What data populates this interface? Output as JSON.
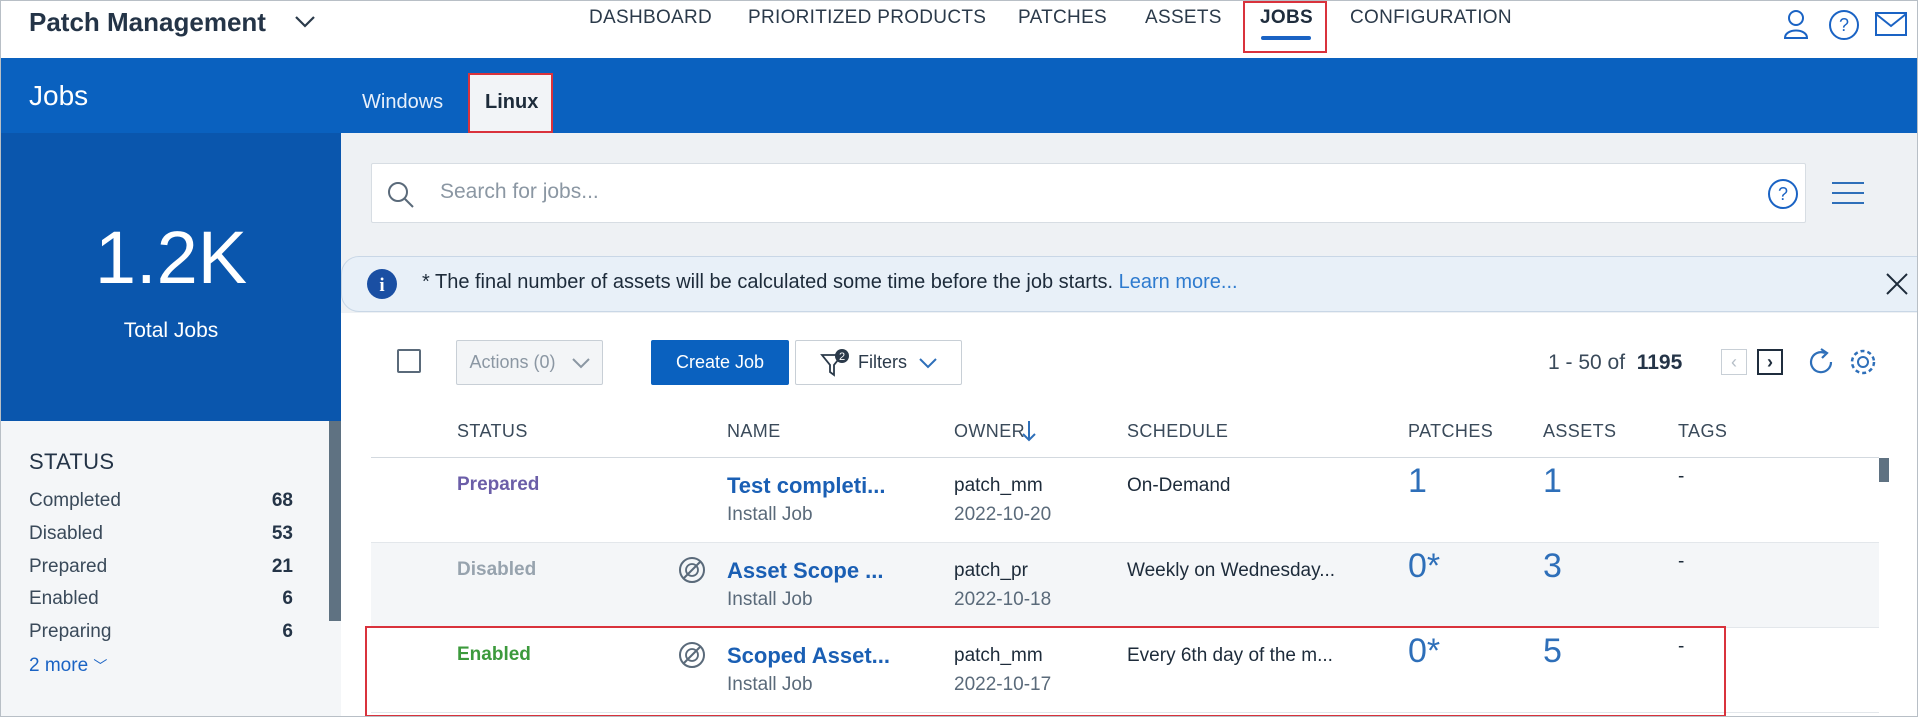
{
  "header": {
    "app_title": "Patch Management",
    "nav": [
      "DASHBOARD",
      "PRIORITIZED PRODUCTS",
      "PATCHES",
      "ASSETS",
      "JOBS",
      "CONFIGURATION"
    ],
    "active_nav": "JOBS"
  },
  "band": {
    "title": "Jobs",
    "tabs": [
      "Windows",
      "Linux"
    ],
    "active_tab": "Linux"
  },
  "kpi": {
    "value": "1.2K",
    "label": "Total Jobs"
  },
  "status": {
    "heading": "STATUS",
    "items": [
      {
        "label": "Completed",
        "count": "68"
      },
      {
        "label": "Disabled",
        "count": "53"
      },
      {
        "label": "Prepared",
        "count": "21"
      },
      {
        "label": "Enabled",
        "count": "6"
      },
      {
        "label": "Preparing",
        "count": "6"
      }
    ],
    "more": "2 more"
  },
  "search": {
    "placeholder": "Search for jobs..."
  },
  "info": {
    "text": "* The final number of assets will be calculated some time before the job starts.",
    "link": "Learn more..."
  },
  "toolbar": {
    "actions": "Actions (0)",
    "create": "Create Job",
    "filters": "Filters",
    "filter_badge": "2",
    "range": "1 - 50 of",
    "total": "1195"
  },
  "columns": [
    "STATUS",
    "NAME",
    "OWNER",
    "SCHEDULE",
    "PATCHES",
    "ASSETS",
    "TAGS"
  ],
  "rows": [
    {
      "status": "Prepared",
      "status_color": "#6b5ea8",
      "name": "Test completi...",
      "type": "Install Job",
      "owner": "patch_mm",
      "date": "2022-10-20",
      "schedule": "On-Demand",
      "patches": "1",
      "assets": "1",
      "tags": "-",
      "scope_icon": false
    },
    {
      "status": "Disabled",
      "status_color": "#97a3ae",
      "name": "Asset Scope ...",
      "type": "Install Job",
      "owner": "patch_pr",
      "date": "2022-10-18",
      "schedule": "Weekly on Wednesday...",
      "patches": "0*",
      "assets": "3",
      "tags": "-",
      "scope_icon": true
    },
    {
      "status": "Enabled",
      "status_color": "#3c9a3c",
      "name": "Scoped Asset...",
      "type": "Install Job",
      "owner": "patch_mm",
      "date": "2022-10-17",
      "schedule": "Every 6th day of the m...",
      "patches": "0*",
      "assets": "5",
      "tags": "-",
      "scope_icon": true
    }
  ]
}
